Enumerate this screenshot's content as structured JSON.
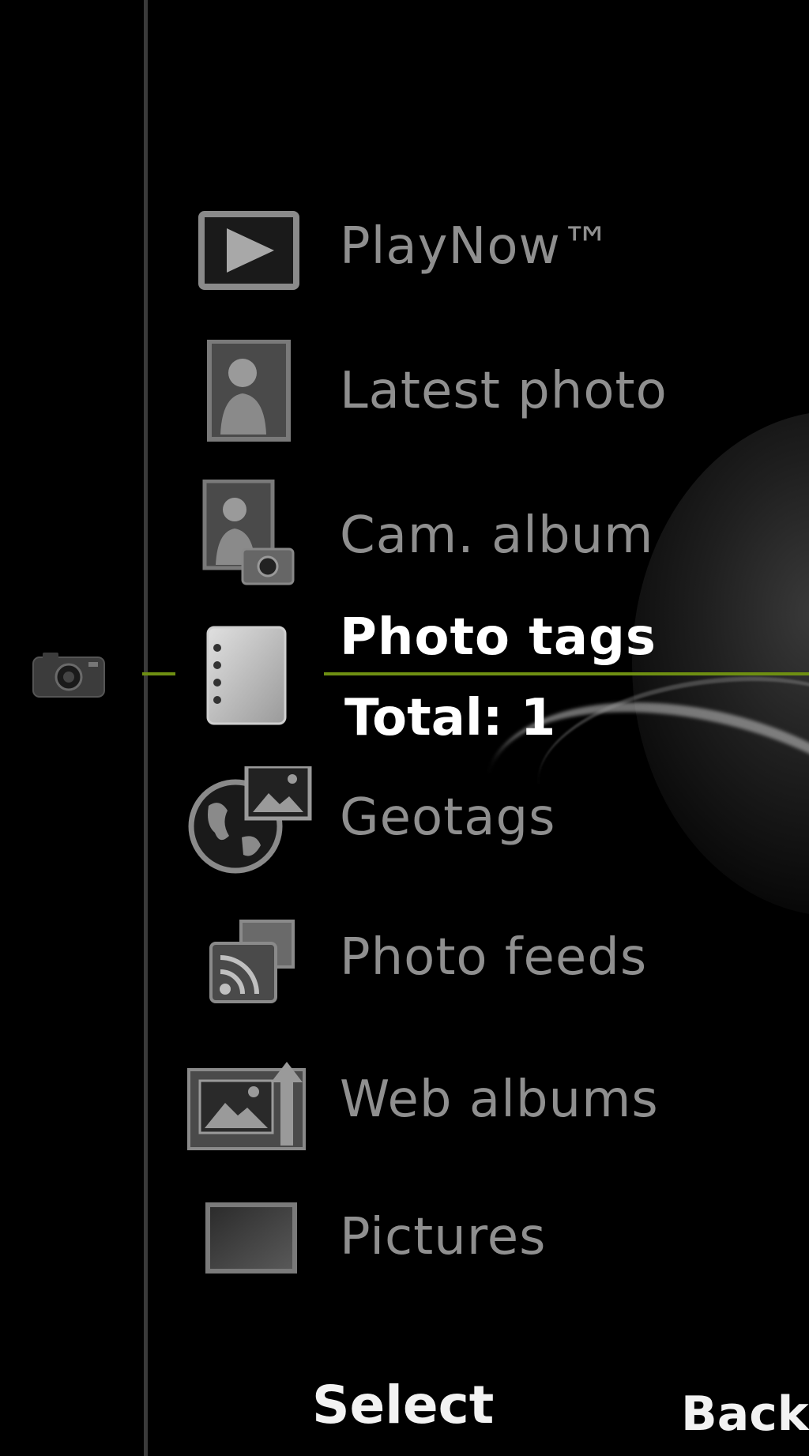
{
  "menu": {
    "items": [
      {
        "label": "PlayNow™",
        "icon": "play-icon"
      },
      {
        "label": "Latest photo",
        "icon": "portrait-icon"
      },
      {
        "label": "Cam. album",
        "icon": "camera-album-icon"
      },
      {
        "label": "Photo tags",
        "icon": "notebook-icon",
        "selected": true,
        "sublabel": "Total: 1"
      },
      {
        "label": "Geotags",
        "icon": "globe-photo-icon"
      },
      {
        "label": "Photo feeds",
        "icon": "rss-feed-icon"
      },
      {
        "label": "Web albums",
        "icon": "upload-album-icon"
      },
      {
        "label": "Pictures",
        "icon": "picture-frame-icon"
      }
    ]
  },
  "sidebar": {
    "icon": "camera-icon"
  },
  "softkeys": {
    "select": "Select",
    "back": "Back"
  },
  "colors": {
    "accent": "#6e8f12",
    "background": "#000000",
    "text_dim": "#8f8f8f",
    "text_selected": "#ffffff"
  }
}
